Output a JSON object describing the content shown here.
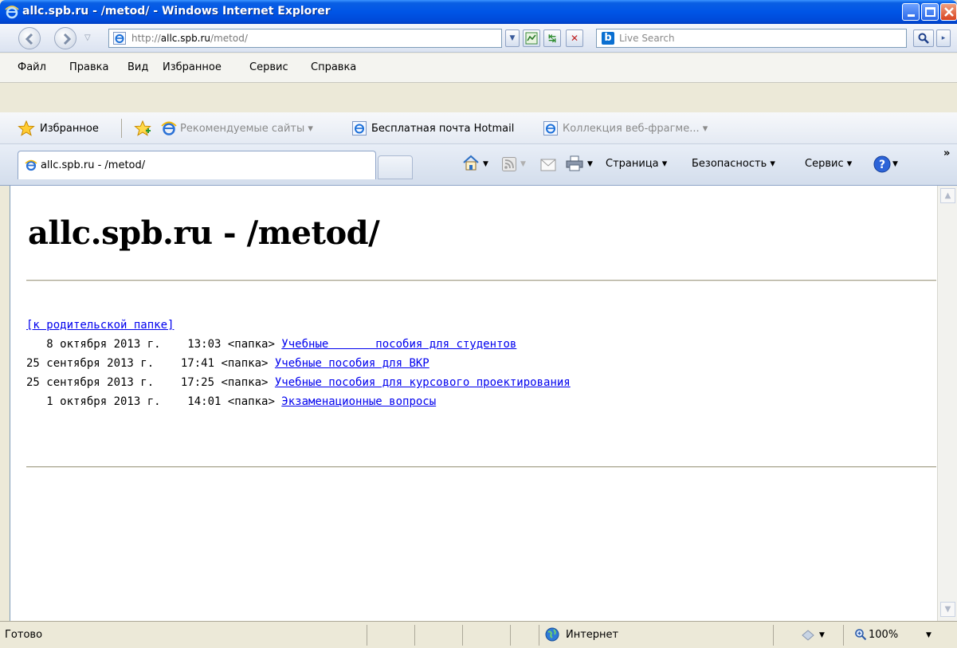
{
  "window": {
    "title": "allc.spb.ru - /metod/ - Windows Internet Explorer"
  },
  "address_bar": {
    "url_prefix": "http://",
    "url_host": "allc.spb.ru",
    "url_path": "/metod/"
  },
  "search": {
    "placeholder": "Live Search"
  },
  "menu": [
    "Файл",
    "Правка",
    "Вид",
    "Избранное",
    "Сервис",
    "Справка"
  ],
  "favorites_bar": {
    "favorites_label": "Избранное",
    "links": [
      {
        "label": "Рекомендуемые сайты ▾"
      },
      {
        "label": "Бесплатная почта Hotmail"
      },
      {
        "label": "Коллекция веб-фрагме... ▾"
      }
    ]
  },
  "tab": {
    "label": "allc.spb.ru - /metod/"
  },
  "command_bar": {
    "page_label": "Страница ▾",
    "safety_label": "Безопасность ▾",
    "tools_label": "Сервис ▾",
    "overflow": "»"
  },
  "page": {
    "heading": "allc.spb.ru - /metod/",
    "parent_link": "[к родительской папке]",
    "rows": [
      {
        "date": "   8 октября 2013 г.",
        "time": "    13:03",
        "type": " <папка> ",
        "name": "Учебные       пособия для студентов"
      },
      {
        "date": "25 сентября 2013 г.",
        "time": "    17:41",
        "type": " <папка> ",
        "name": "Учебные пособия для ВКР"
      },
      {
        "date": "25 сентября 2013 г.",
        "time": "    17:25",
        "type": " <папка> ",
        "name": "Учебные пособия для курсового проектирования"
      },
      {
        "date": "   1 октября 2013 г.",
        "time": "    14:01",
        "type": " <папка> ",
        "name": "Экзаменационные вопросы"
      }
    ]
  },
  "status_bar": {
    "status": "Готово",
    "zone": "Интернет",
    "zoom": "100%"
  }
}
